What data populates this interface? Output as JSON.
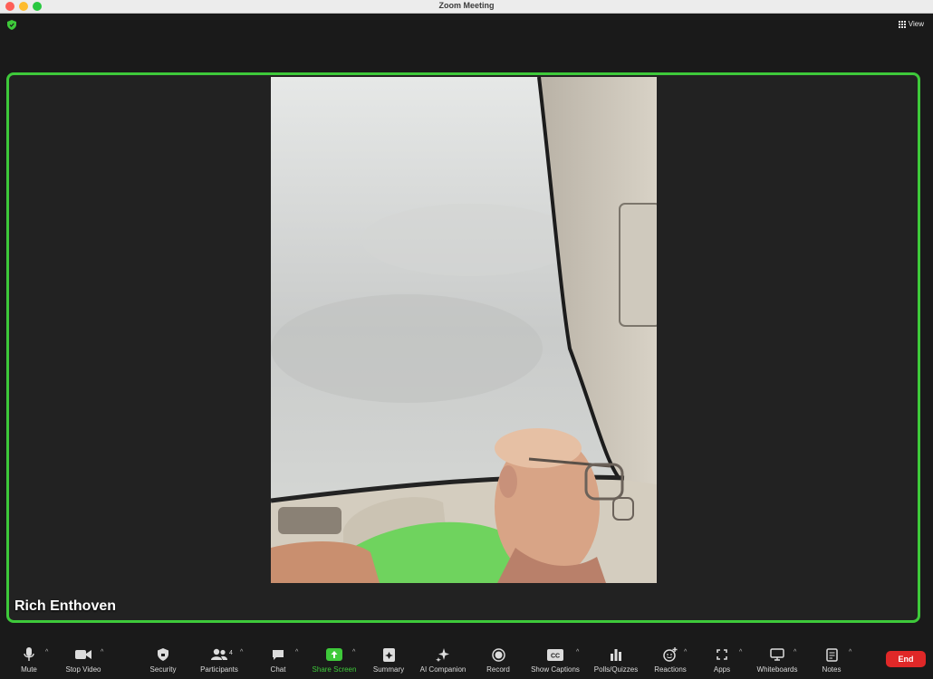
{
  "window": {
    "title": "Zoom Meeting"
  },
  "topbar": {
    "view_label": "View"
  },
  "participant": {
    "name": "Rich Enthoven"
  },
  "toolbar": {
    "mute": "Mute",
    "stop_video": "Stop Video",
    "security": "Security",
    "participants": "Participants",
    "participants_count": "4",
    "chat": "Chat",
    "share_screen": "Share Screen",
    "summary": "Summary",
    "ai_companion": "AI Companion",
    "record": "Record",
    "show_captions": "Show Captions",
    "polls": "Polls/Quizzes",
    "reactions": "Reactions",
    "apps": "Apps",
    "whiteboards": "Whiteboards",
    "notes": "Notes",
    "end": "End"
  },
  "colors": {
    "accent_green": "#3ec93a",
    "end_red": "#e02828",
    "background": "#1a1a1a"
  }
}
